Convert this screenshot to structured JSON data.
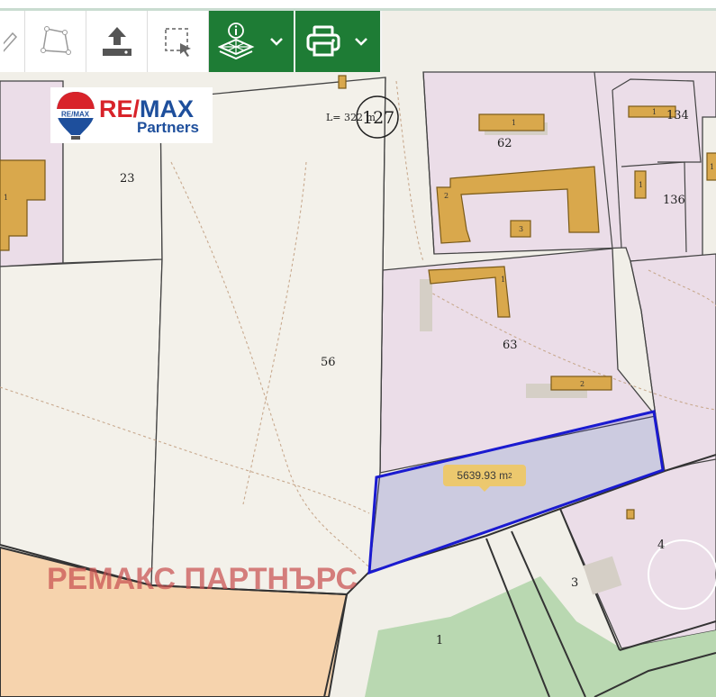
{
  "toolbar": {
    "buttons": [
      {
        "name": "draw-line-tool",
        "icon": "pencil-icon"
      },
      {
        "name": "draw-polygon-tool",
        "icon": "polygon-icon"
      },
      {
        "name": "upload-tool",
        "icon": "upload-icon"
      },
      {
        "name": "select-area-tool",
        "icon": "select-area-icon"
      },
      {
        "name": "info-layers-menu",
        "icon": "info-layers-icon",
        "dropdown": "chevron-down-icon"
      },
      {
        "name": "print-menu",
        "icon": "printer-icon",
        "dropdown": "chevron-down-icon"
      }
    ],
    "accent_color": "#1e7c35"
  },
  "logo": {
    "brand_re": "RE/",
    "brand_max": "MAX",
    "subtitle": "Partners"
  },
  "map": {
    "parcel_labels": {
      "p23": "23",
      "p56": "56",
      "p62": "62",
      "p63": "63",
      "p134": "134",
      "p136": "136",
      "p127": "127",
      "p4": "4",
      "p3": "3",
      "p1": "1"
    },
    "line_length": "L= 322 m",
    "building_labels": {
      "b1a": "1",
      "b1b": "1",
      "b2a": "2",
      "b3": "3",
      "b1c": "1",
      "b2b": "2",
      "b1d": "1",
      "b1e": "1",
      "b1f": "1"
    },
    "measurement": "5639.93 m",
    "measurement_unit_sup": "2",
    "selection_color": "#1a1ad0"
  },
  "watermark": "РЕМАКС ПАРТНЪРС"
}
